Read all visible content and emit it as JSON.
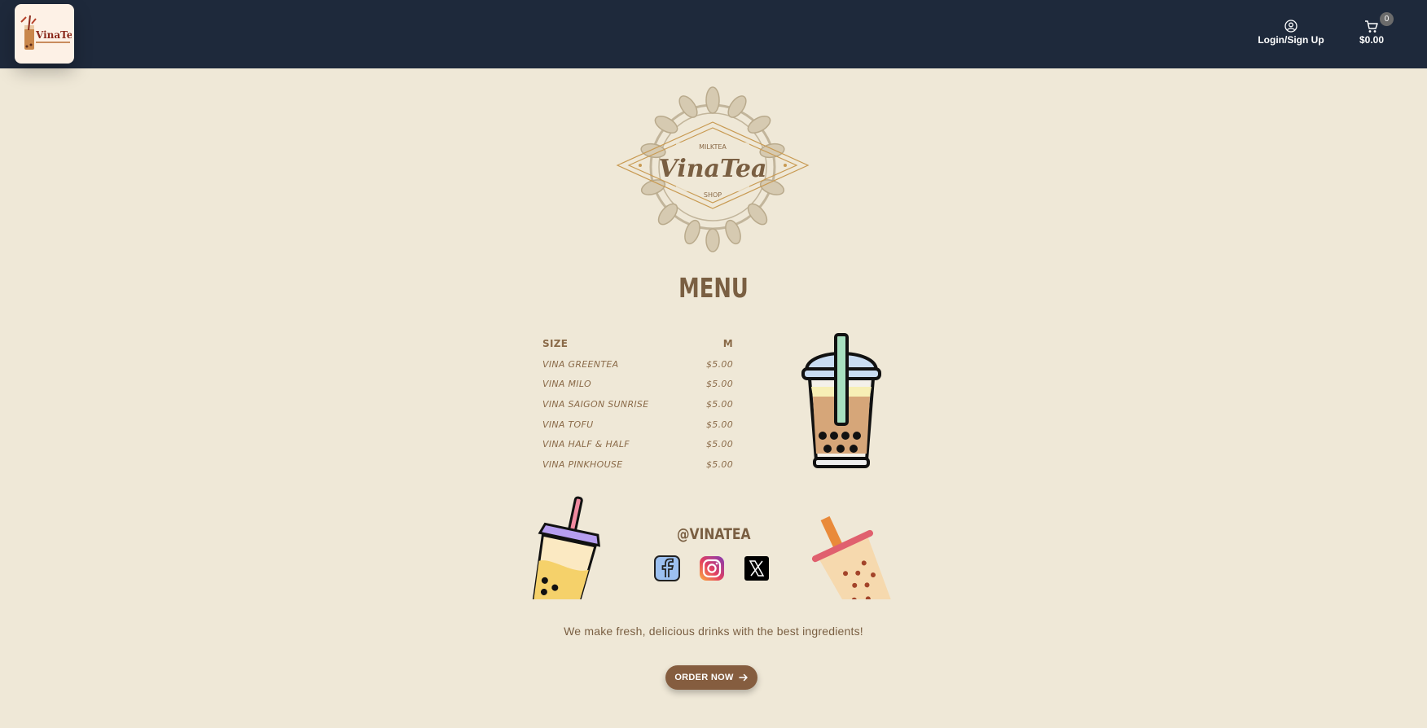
{
  "header": {
    "logo_text": "VinaTea",
    "login_label": "Login/Sign Up",
    "cart_total": "$0.00",
    "cart_count": "0"
  },
  "emblem": {
    "top_text": "MILKTEA",
    "brand": "VinaTea",
    "bottom_text": "SHOP"
  },
  "menu": {
    "title": "MENU",
    "header": {
      "name": "SIZE",
      "size": "M"
    },
    "items": [
      {
        "name": "VINA GREENTEA",
        "price": "$5.00"
      },
      {
        "name": "VINA MILO",
        "price": "$5.00"
      },
      {
        "name": "VINA SAIGON SUNRISE",
        "price": "$5.00"
      },
      {
        "name": "VINA TOFU",
        "price": "$5.00"
      },
      {
        "name": "VINA HALF & HALF",
        "price": "$5.00"
      },
      {
        "name": "VINA PINKHOUSE",
        "price": "$5.00"
      }
    ]
  },
  "social": {
    "handle": "@VINATEA",
    "icons": [
      "facebook-icon",
      "instagram-icon",
      "x-icon"
    ]
  },
  "tagline": "We make fresh, delicious drinks with the best ingredients!",
  "cta": {
    "label": "ORDER NOW",
    "icon": "arrow-right-icon"
  },
  "colors": {
    "header_bg": "#1e293b",
    "page_bg": "#efe8d7",
    "brown_text": "#7a5f42",
    "button_bg": "#855d3f"
  }
}
